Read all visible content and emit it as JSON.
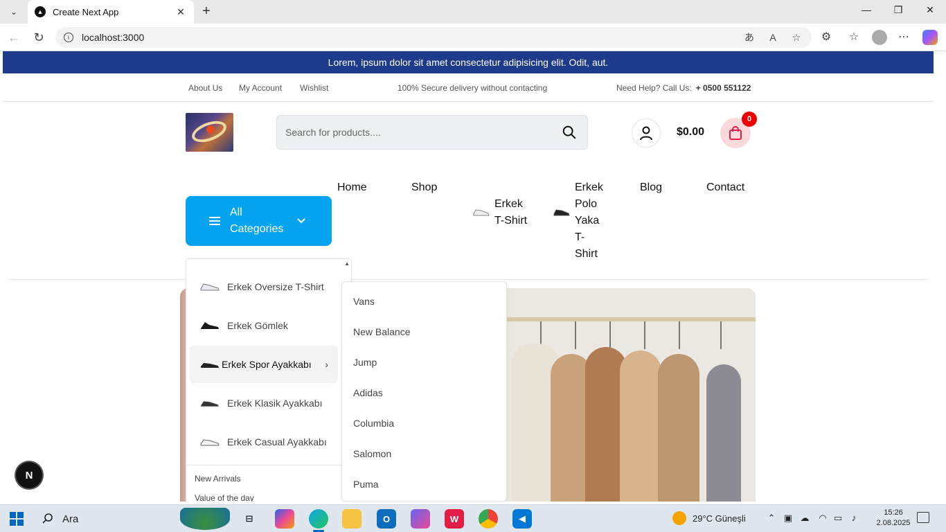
{
  "browser": {
    "tab_title": "Create Next App",
    "tab_close": "✕",
    "new_tab": "+",
    "url": "localhost:3000",
    "window_controls": [
      "—",
      "❐",
      "✕"
    ]
  },
  "promo": {
    "text": "Lorem, ipsum dolor sit amet consectetur adipisicing elit. Odit, aut."
  },
  "topnav": {
    "links": [
      "About Us",
      "My Account",
      "Wishlist"
    ],
    "delivery": "100% Secure delivery without contacting",
    "help_label": "Need Help? Call Us:",
    "help_phone": "+ 0500 551122"
  },
  "search": {
    "placeholder": "Search for products...."
  },
  "cart": {
    "total": "$0.00",
    "count": "0"
  },
  "categories_button": {
    "label": "All Categories"
  },
  "mainnav": {
    "home": "Home",
    "shop": "Shop",
    "cat1": "Erkek T-Shirt",
    "cat2": "Erkek Polo Yaka T-Shirt",
    "blog": "Blog",
    "contact": "Contact"
  },
  "category_panel": {
    "items": [
      "Erkek Oversize T-Shirt",
      "Erkek Gömlek",
      "Erkek Spor Ayakkabı",
      "Erkek Klasik Ayakkabı",
      "Erkek Casual Ayakkabı"
    ],
    "active_index": 2,
    "extra_links": [
      "New Arrivals",
      "Value of the day"
    ]
  },
  "submenu": {
    "brands": [
      "Vans",
      "New Balance",
      "Jump",
      "Adidas",
      "Columbia",
      "Salomon",
      "Puma"
    ]
  },
  "dev_badge": {
    "label": "N"
  },
  "taskbar": {
    "search_text": "Ara",
    "weather": "29°C  Güneşli",
    "time": "15:26",
    "date": "2.08.2025",
    "accent": "#0067c0"
  }
}
